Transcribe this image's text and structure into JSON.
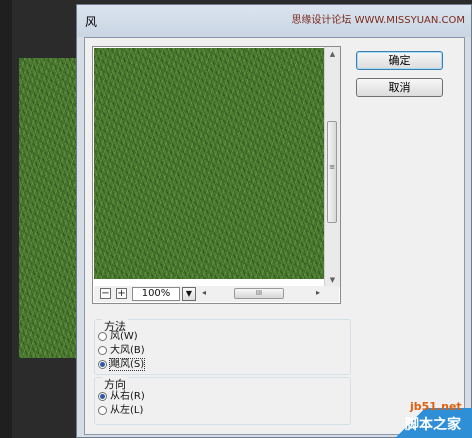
{
  "dialog": {
    "title": "风",
    "watermark_top": "思缘设计论坛 WWW.MISSYUAN.COM"
  },
  "buttons": {
    "ok": "确定",
    "cancel": "取消"
  },
  "preview": {
    "zoom_minus": "−",
    "zoom_plus": "+",
    "zoom_level": "100%",
    "dropdown_glyph": "▼",
    "scroll_left_glyph": "◂",
    "scroll_right_glyph": "▸",
    "hthumb_grip": "III",
    "scroll_up_glyph": "▲",
    "scroll_down_glyph": "▼",
    "vthumb_grip": "≡"
  },
  "method": {
    "title": "方法",
    "options": [
      {
        "label": "风(W)",
        "checked": false
      },
      {
        "label": "大风(B)",
        "checked": false
      },
      {
        "label": "飓风(S)",
        "checked": true
      }
    ]
  },
  "direction": {
    "title": "方向",
    "options": [
      {
        "label": "从右(R)",
        "checked": true
      },
      {
        "label": "从左(L)",
        "checked": false
      }
    ]
  },
  "watermark": {
    "site": "jb51.net",
    "brand": "脚本之家"
  },
  "colors": {
    "grass": "#4a7a30",
    "dialog_frame": "#d6dde7",
    "client": "#f0f0f0",
    "watermark_blue": "#2f8fd6"
  }
}
